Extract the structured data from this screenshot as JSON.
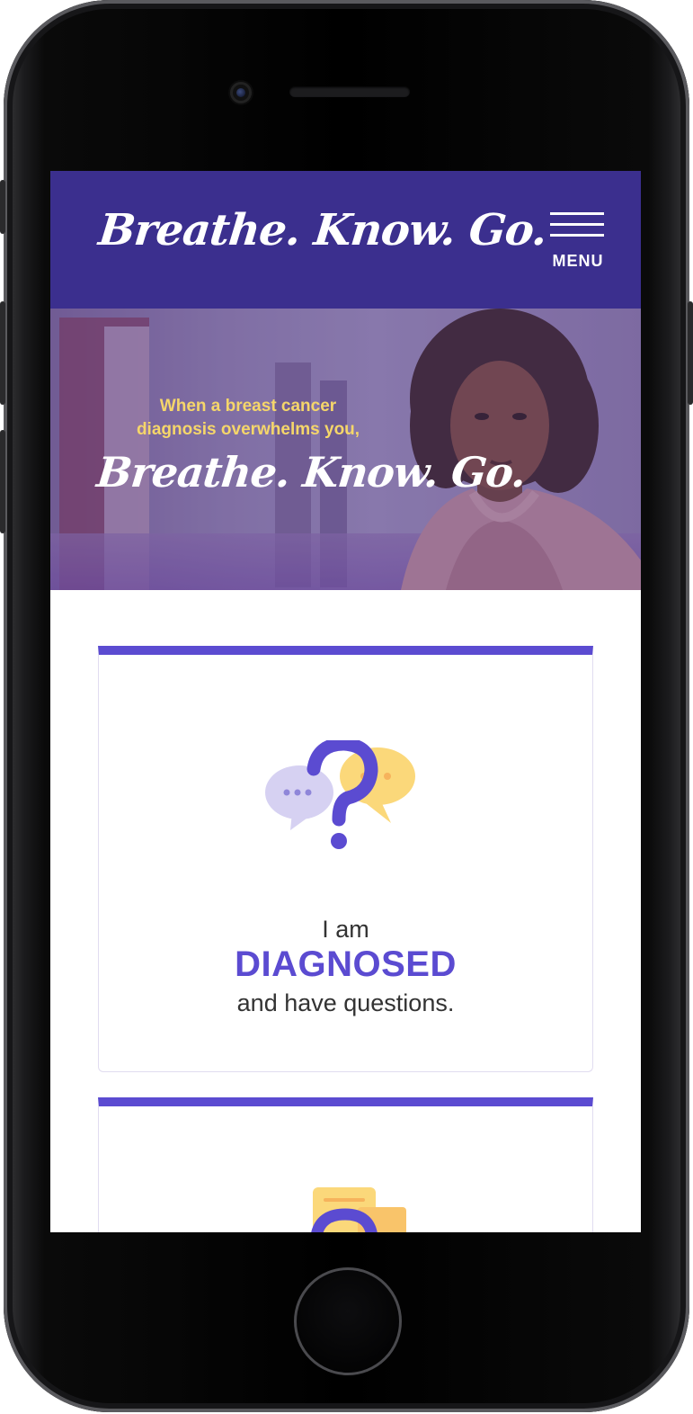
{
  "header": {
    "logo": "Breathe. Know. Go.",
    "menu_label": "MENU"
  },
  "hero": {
    "tagline_line1": "When a breast cancer",
    "tagline_line2": "diagnosis overwhelms you,",
    "logo": "Breathe. Know. Go."
  },
  "cards": [
    {
      "icon": "question-chat-icon",
      "line1": "I am",
      "line2": "DIAGNOSED",
      "line3": "and have questions."
    },
    {
      "icon": "document-question-icon"
    }
  ],
  "colors": {
    "header_bg": "#3b2f8e",
    "accent": "#5b4bd1",
    "tagline": "#f5d66a"
  }
}
